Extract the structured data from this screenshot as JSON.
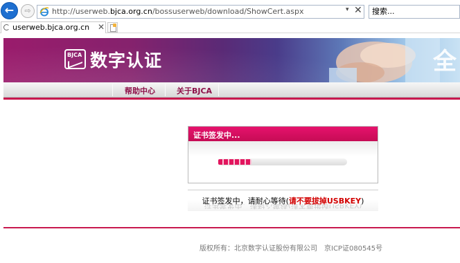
{
  "browser": {
    "url_prefix": "http://userweb.",
    "url_domain": "bjca.org.cn",
    "url_suffix": "/bossuserweb/download/ShowCert.aspx",
    "search_placeholder": "搜索...",
    "tab_title": "userweb.bjca.org.cn",
    "back_glyph": "←",
    "forward_glyph": "⇨",
    "dropdown_glyph": "▾",
    "stop_glyph": "✕",
    "close_glyph": "✕"
  },
  "banner": {
    "logo_text": "BJCA",
    "brand_name": "数字认证",
    "right_char": "全"
  },
  "nav": {
    "items": [
      {
        "label": "帮助中心"
      },
      {
        "label": "关于BJCA"
      }
    ]
  },
  "panel": {
    "title": "证书签发中...",
    "progress": 0.26
  },
  "notice": {
    "text": "证书签发中，请耐心等待(",
    "warning": "请不要拔掉USBKEY",
    "close_paren": ")"
  },
  "footer": {
    "copyright": "版权所有：北京数字认证股份有限公司　京ICP证080545号"
  },
  "colors": {
    "accent": "#c8184e",
    "panel_header": "#e6126d",
    "nav_text": "#8d1048",
    "warning": "#d20000"
  },
  "icons": [
    "back-arrow-icon",
    "forward-arrow-icon",
    "ie-logo-icon",
    "loading-spinner-icon",
    "new-tab-icon",
    "bjca-logo-icon"
  ]
}
